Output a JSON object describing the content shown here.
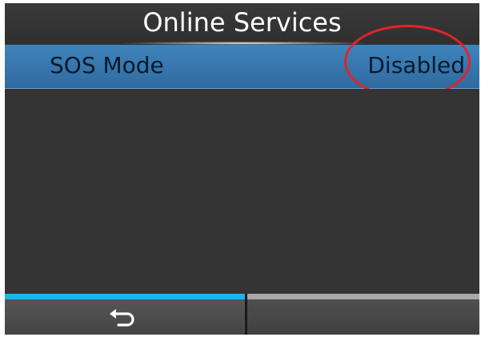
{
  "title": "Online Services",
  "menu": {
    "items": [
      {
        "label": "SOS Mode",
        "value": "Disabled",
        "selected": true
      }
    ]
  },
  "annotation": {
    "highlight_color": "#e2232a"
  },
  "softkeys": {
    "left": {
      "icon": "return-arrow-icon",
      "active_color": "#16b8ef"
    },
    "right": {
      "icon": ""
    }
  },
  "colors": {
    "screen_bg": "#333333",
    "selected_row": "#3a7ab3",
    "text_primary": "#ffffff"
  }
}
